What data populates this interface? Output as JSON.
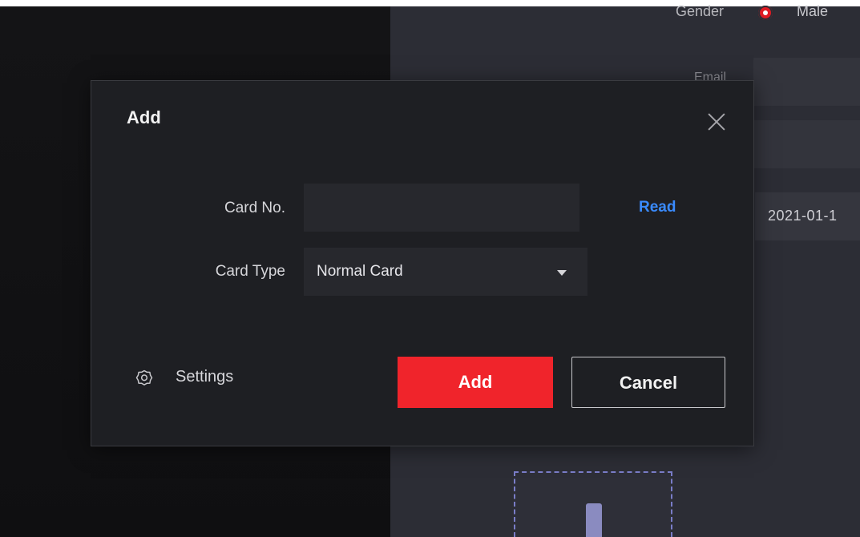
{
  "background": {
    "gender_label": "Gender",
    "gender_value": "Male",
    "email_label": "Email",
    "date_value": "2021-01-1"
  },
  "dialog": {
    "title": "Add",
    "card_no": {
      "label": "Card No.",
      "value": "",
      "read_label": "Read"
    },
    "card_type": {
      "label": "Card Type",
      "selected": "Normal Card"
    },
    "settings_label": "Settings",
    "add_button_label": "Add",
    "cancel_button_label": "Cancel"
  },
  "colors": {
    "accent": "#f0242b",
    "link": "#3a8bff",
    "dialog_bg": "#1e1f23"
  },
  "icons": {
    "close": "close-icon",
    "dropdown": "chevron-down-icon",
    "settings": "gear-icon"
  }
}
